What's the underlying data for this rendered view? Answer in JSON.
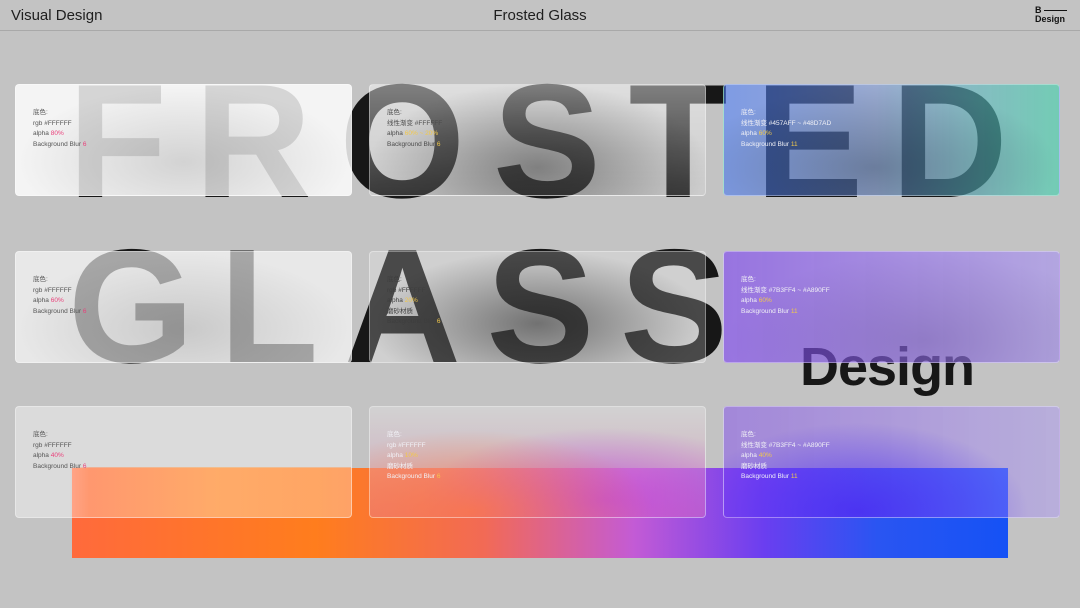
{
  "header": {
    "left_title": "Visual Design",
    "center_title": "Frosted Glass",
    "logo_top": "B",
    "logo_bottom": "Design"
  },
  "art": {
    "row1_letters": [
      "F",
      "R",
      "O",
      "S",
      "T",
      "E",
      "D"
    ],
    "row2_letters": [
      "G",
      "L",
      "A",
      "S",
      "S"
    ],
    "design_word": "Design",
    "gradient_colors": [
      "#ff6a3c",
      "#ff7d1d",
      "#c35bd5",
      "#1552f5"
    ]
  },
  "cards": {
    "r1c1": {
      "label": "底色:",
      "l1": "rgb #FFFFFF",
      "alpha_label": "alpha",
      "alpha_value": "80%",
      "blur_label": "Background Blur",
      "blur_value": "6"
    },
    "r1c2": {
      "label": "底色:",
      "l1": "线性渐变 #FFFFFF",
      "alpha_label": "alpha",
      "alpha_value": "60% ~ 20%",
      "blur_label": "Background Blur",
      "blur_value": "6"
    },
    "r1c3": {
      "label": "底色:",
      "l1": "线性渐变 #457AFF ~ #48D7AD",
      "alpha_label": "alpha",
      "alpha_value": "60%",
      "blur_label": "Background Blur",
      "blur_value": "11"
    },
    "r2c1": {
      "label": "底色:",
      "l1": "rgb #FFFFFF",
      "alpha_label": "alpha",
      "alpha_value": "60%",
      "blur_label": "Background Blur",
      "blur_value": "6"
    },
    "r2c2": {
      "label": "底色:",
      "l1": "rgb #FFFFFF",
      "alpha_label": "alpha",
      "alpha_value": "20%",
      "extra": "磨砂材质",
      "blur_label": "Background Blur",
      "blur_value": "6"
    },
    "r2c3": {
      "label": "底色:",
      "l1": "线性渐变 #7B3FF4 ~ #A890FF",
      "alpha_label": "alpha",
      "alpha_value": "60%",
      "blur_label": "Background Blur",
      "blur_value": "11"
    },
    "r3c1": {
      "label": "底色:",
      "l1": "rgb #FFFFFF",
      "alpha_label": "alpha",
      "alpha_value": "40%",
      "blur_label": "Background Blur",
      "blur_value": "6"
    },
    "r3c2": {
      "label": "底色:",
      "l1": "rgb #FFFFFF",
      "alpha_label": "alpha",
      "alpha_value": "10%",
      "extra": "磨砂材质",
      "blur_label": "Background Blur",
      "blur_value": "6"
    },
    "r3c3": {
      "label": "底色:",
      "l1": "线性渐变 #7B3FF4 ~ #A890FF",
      "alpha_label": "alpha",
      "alpha_value": "40%",
      "extra": "磨砂材质",
      "blur_label": "Background Blur",
      "blur_value": "11"
    }
  },
  "colors": {
    "highlight_pink": "#ea3f7a",
    "highlight_yellow": "#f2c84a",
    "background": "#c3c3c3"
  }
}
